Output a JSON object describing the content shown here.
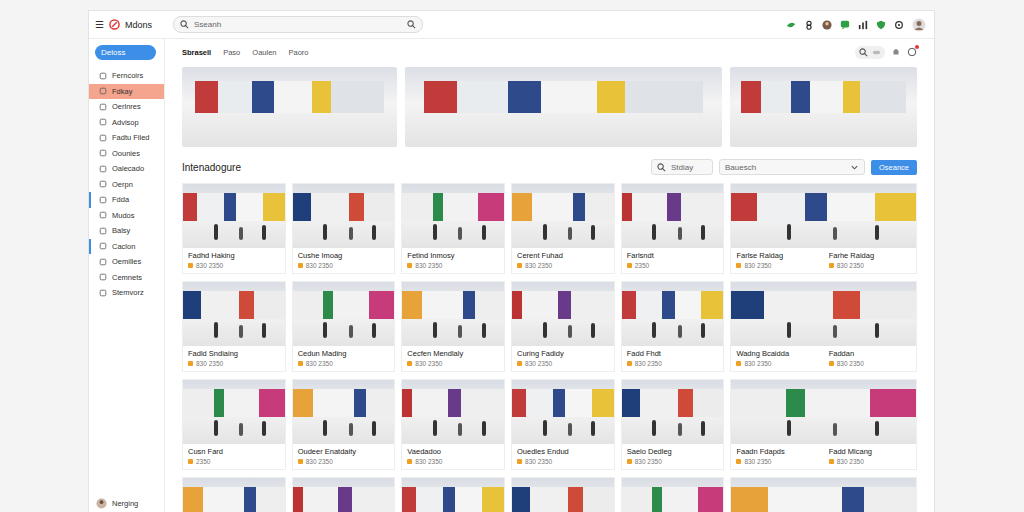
{
  "app": {
    "menu_icon": "☰",
    "name": "Mdons"
  },
  "search": {
    "placeholder": "Sseanh"
  },
  "sidebar": {
    "button": "Deloss",
    "items": [
      {
        "label": "Ferncoirs",
        "selected": false,
        "marked": false
      },
      {
        "label": "Fdkay",
        "selected": true,
        "marked": false
      },
      {
        "label": "Oerlnres",
        "selected": false,
        "marked": false
      },
      {
        "label": "Advisop",
        "selected": false,
        "marked": false
      },
      {
        "label": "Fadtu Filed",
        "selected": false,
        "marked": false
      },
      {
        "label": "Oounies",
        "selected": false,
        "marked": false
      },
      {
        "label": "Oalecado",
        "selected": false,
        "marked": false
      },
      {
        "label": "Oerpn",
        "selected": false,
        "marked": false
      },
      {
        "label": "Fdda",
        "selected": false,
        "marked": true
      },
      {
        "label": "Mudos",
        "selected": false,
        "marked": false
      },
      {
        "label": "Balsy",
        "selected": false,
        "marked": false
      },
      {
        "label": "Caclon",
        "selected": false,
        "marked": true
      },
      {
        "label": "Oemilles",
        "selected": false,
        "marked": false
      },
      {
        "label": "Cemnets",
        "selected": false,
        "marked": false
      },
      {
        "label": "Stemvorz",
        "selected": false,
        "marked": false
      }
    ],
    "user": "Nerging"
  },
  "tabs": [
    {
      "label": "Sbrasell",
      "selected": true
    },
    {
      "label": "Paso",
      "selected": false
    },
    {
      "label": "Oaulen",
      "selected": false
    },
    {
      "label": "Paoro",
      "selected": false
    }
  ],
  "section": {
    "title": "Intenadogure",
    "filter_placeholder": "Stdiay",
    "sort": "Bauesch",
    "button": "Oseance"
  },
  "cards": [
    {
      "kind": "normal",
      "captions": [
        {
          "title": "Fadhd Haking",
          "meta": "830 2350"
        }
      ]
    },
    {
      "kind": "normal",
      "captions": [
        {
          "title": "Cushe Imoag",
          "meta": "830 2350"
        }
      ]
    },
    {
      "kind": "normal",
      "captions": [
        {
          "title": "Fetind Inmosy",
          "meta": "830 2350"
        }
      ]
    },
    {
      "kind": "normal",
      "captions": [
        {
          "title": "Cerent Fuhad",
          "meta": "830 2350"
        }
      ]
    },
    {
      "kind": "normal",
      "captions": [
        {
          "title": "Farlsndt",
          "meta": "2350"
        }
      ]
    },
    {
      "kind": "wide",
      "captions": [
        {
          "title": "Farlse Raidag",
          "meta": "830 2350"
        },
        {
          "title": "Farhe Raidag",
          "meta": "830 2350"
        }
      ]
    },
    {
      "kind": "normal",
      "captions": [
        {
          "title": "Fadld Sndiaing",
          "meta": "830 2350"
        }
      ]
    },
    {
      "kind": "normal",
      "captions": [
        {
          "title": "Cedun Mading",
          "meta": "830 2350"
        }
      ]
    },
    {
      "kind": "normal",
      "captions": [
        {
          "title": "Cecfen Mendlaly",
          "meta": "830 2350"
        }
      ]
    },
    {
      "kind": "normal",
      "captions": [
        {
          "title": "Curing Fadidy",
          "meta": "830 2350"
        }
      ]
    },
    {
      "kind": "normal",
      "captions": [
        {
          "title": "Fadd Fhdt",
          "meta": "830 2350"
        }
      ]
    },
    {
      "kind": "wide",
      "captions": [
        {
          "title": "Wadng Bcaidda",
          "meta": "830 2350"
        },
        {
          "title": "Faddan",
          "meta": "830 2350"
        }
      ]
    },
    {
      "kind": "normal",
      "captions": [
        {
          "title": "Cusn Fard",
          "meta": "2350"
        }
      ]
    },
    {
      "kind": "normal",
      "captions": [
        {
          "title": "Oudeer Enatdaity",
          "meta": "830 2350"
        }
      ]
    },
    {
      "kind": "normal",
      "captions": [
        {
          "title": "Vaedadoo",
          "meta": "830 2350"
        }
      ]
    },
    {
      "kind": "normal",
      "captions": [
        {
          "title": "Ouedles Endud",
          "meta": "830 2350"
        }
      ]
    },
    {
      "kind": "normal",
      "captions": [
        {
          "title": "Saelo Dedleg",
          "meta": "830 2350"
        }
      ]
    },
    {
      "kind": "wide",
      "captions": [
        {
          "title": "Faadn Fdapds",
          "meta": "830 2350"
        },
        {
          "title": "Fadd Mlcang",
          "meta": "830 2350"
        }
      ]
    },
    {
      "kind": "normal",
      "captions": []
    },
    {
      "kind": "normal",
      "captions": []
    },
    {
      "kind": "normal",
      "captions": []
    },
    {
      "kind": "normal",
      "captions": []
    },
    {
      "kind": "normal",
      "captions": []
    },
    {
      "kind": "wide",
      "captions": []
    }
  ]
}
